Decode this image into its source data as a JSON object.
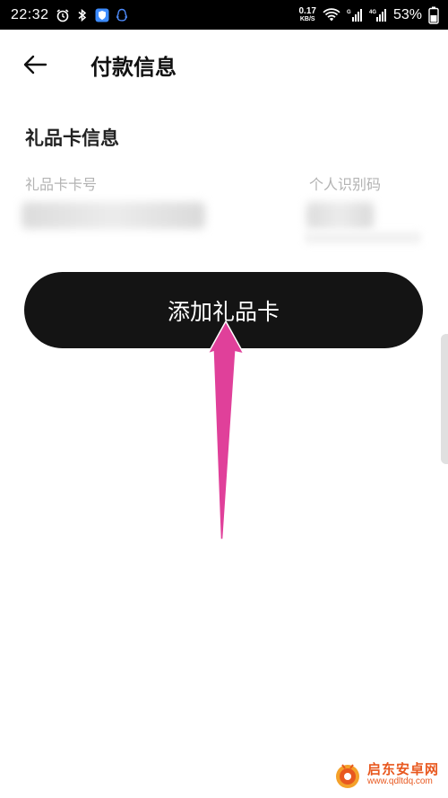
{
  "status_bar": {
    "time": "22:32",
    "speed_value": "0.17",
    "speed_unit": "KB/S",
    "network_badge": "4G",
    "battery_percent": "53%",
    "icons": [
      "alarm-icon",
      "bluetooth-icon",
      "shield-app-icon",
      "qq-icon",
      "wifi-icon",
      "signal-icon",
      "signal-4g-icon",
      "battery-icon"
    ]
  },
  "header": {
    "back_icon": "back-arrow-icon",
    "title": "付款信息"
  },
  "gift_card": {
    "section_title": "礼品卡信息",
    "card_number_label": "礼品卡卡号",
    "pin_label": "个人识别码"
  },
  "add_button": {
    "label": "添加礼品卡"
  },
  "annotation": {
    "arrow_color": "#e0409a"
  },
  "watermark": {
    "name": "启东安卓网",
    "url": "www.qdltdq.com"
  },
  "colors": {
    "button_bg": "#141414",
    "accent_watermark": "#e8581f"
  }
}
